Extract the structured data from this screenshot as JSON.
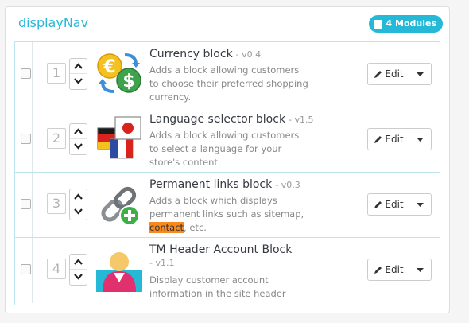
{
  "hook": {
    "title": "displayNav",
    "badge_label": "4 Modules",
    "badge_icon": "module-square-icon"
  },
  "modules": [
    {
      "position": "1",
      "name": "Currency block",
      "version": "- v0.4",
      "description": "Adds a block allowing customers to choose their preferred shopping currency.",
      "icon": "currency-exchange-icon",
      "edit_label": "Edit"
    },
    {
      "position": "2",
      "name": "Language selector block",
      "version": "- v1.5",
      "description": "Adds a block allowing customers to select a language for your store's content.",
      "icon": "language-flags-icon",
      "edit_label": "Edit"
    },
    {
      "position": "3",
      "name": "Permanent links block",
      "version": "- v0.3",
      "description_before": "Adds a block which displays permanent links such as sitemap,",
      "description_highlight": "contact",
      "description_after": ", etc.",
      "icon": "chain-link-add-icon",
      "edit_label": "Edit"
    },
    {
      "position": "4",
      "name": "TM Header Account Block",
      "version": "- v1.1",
      "description": "Display customer account information in the site header",
      "icon": "user-avatar-icon",
      "edit_label": "Edit"
    }
  ],
  "colors": {
    "accent": "#25b9d7",
    "highlight": "#f7891f",
    "row_border": "#bde5ee"
  }
}
